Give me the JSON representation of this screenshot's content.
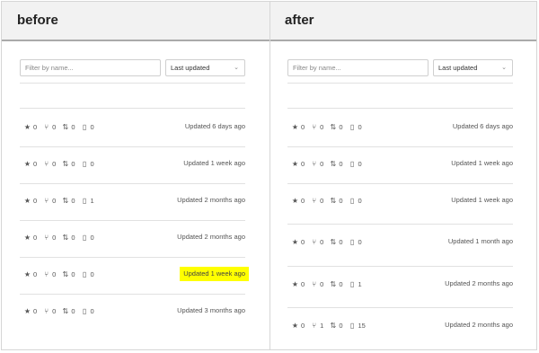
{
  "columns": [
    {
      "title": "before",
      "filter_placeholder": "Filter by name...",
      "sort_label": "Last updated",
      "rows": [
        {
          "stars": "0",
          "forks": "0",
          "prs": "0",
          "issues": "0",
          "updated": "Updated 6 days ago",
          "highlight": false
        },
        {
          "stars": "0",
          "forks": "0",
          "prs": "0",
          "issues": "0",
          "updated": "Updated 1 week ago",
          "highlight": false
        },
        {
          "stars": "0",
          "forks": "0",
          "prs": "0",
          "issues": "1",
          "updated": "Updated 2 months ago",
          "highlight": false
        },
        {
          "stars": "0",
          "forks": "0",
          "prs": "0",
          "issues": "0",
          "updated": "Updated 2 months ago",
          "highlight": false
        },
        {
          "stars": "0",
          "forks": "0",
          "prs": "0",
          "issues": "0",
          "updated": "Updated 1 week ago",
          "highlight": true
        },
        {
          "stars": "0",
          "forks": "0",
          "prs": "0",
          "issues": "0",
          "updated": "Updated 3 months ago",
          "highlight": false
        }
      ]
    },
    {
      "title": "after",
      "filter_placeholder": "Filter by name...",
      "sort_label": "Last updated",
      "rows": [
        {
          "stars": "0",
          "forks": "0",
          "prs": "0",
          "issues": "0",
          "updated": "Updated 6 days ago",
          "highlight": false
        },
        {
          "stars": "0",
          "forks": "0",
          "prs": "0",
          "issues": "0",
          "updated": "Updated 1 week ago",
          "highlight": false
        },
        {
          "stars": "0",
          "forks": "0",
          "prs": "0",
          "issues": "0",
          "updated": "Updated 1 week ago",
          "highlight": false
        },
        {
          "stars": "0",
          "forks": "0",
          "prs": "0",
          "issues": "0",
          "updated": "Updated 1 month ago",
          "highlight": false
        },
        {
          "stars": "0",
          "forks": "0",
          "prs": "0",
          "issues": "1",
          "updated": "Updated 2 months ago",
          "highlight": false
        },
        {
          "stars": "0",
          "forks": "1",
          "prs": "0",
          "issues": "15",
          "updated": "Updated 2 months ago",
          "highlight": false
        }
      ]
    }
  ],
  "icons": {
    "stars": "star-icon",
    "forks": "fork-icon",
    "prs": "pull-request-icon",
    "issues": "issue-icon"
  },
  "colors": {
    "highlight": "#ffff00",
    "header_bg": "#f2f2f2"
  }
}
